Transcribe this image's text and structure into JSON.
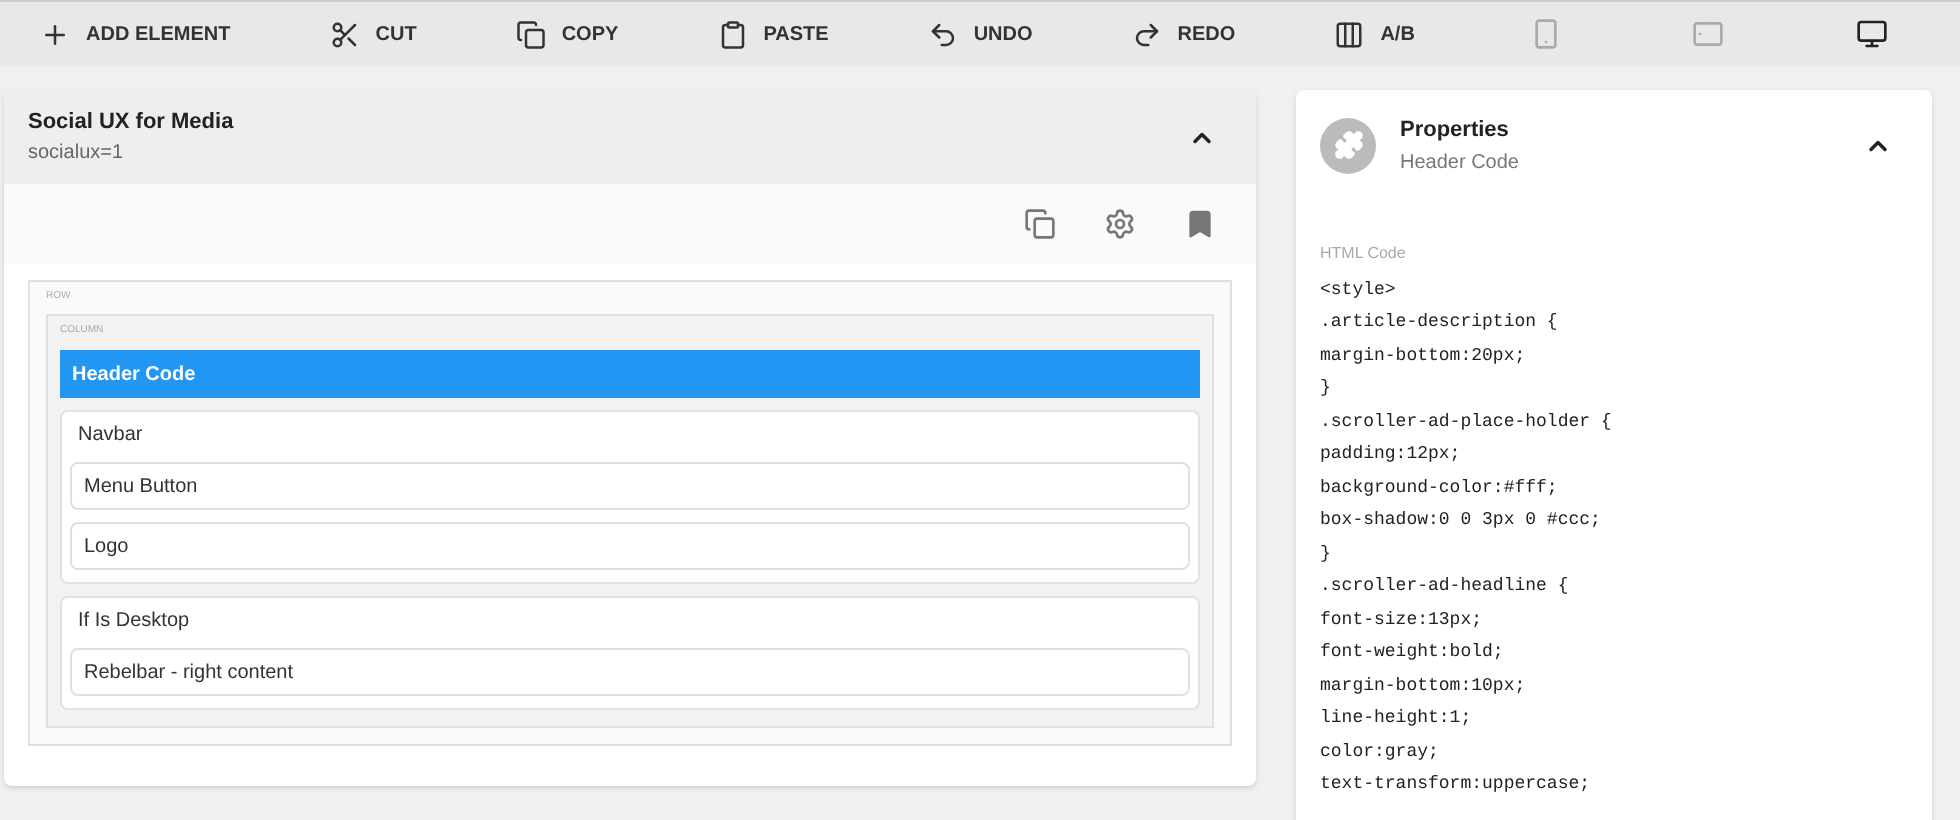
{
  "toolbar": [
    {
      "kind": "action",
      "label": "ADD ELEMENT"
    },
    {
      "kind": "action",
      "label": "CUT"
    },
    {
      "kind": "action",
      "label": "COPY"
    },
    {
      "kind": "action",
      "label": "PASTE"
    },
    {
      "kind": "action",
      "label": "UNDO"
    },
    {
      "kind": "action",
      "label": "REDO"
    },
    {
      "kind": "action",
      "label": "A/B"
    },
    {
      "kind": "device",
      "selected": false
    },
    {
      "kind": "device",
      "selected": false
    },
    {
      "kind": "device",
      "selected": true
    }
  ],
  "layout_panel": {
    "title": "Social UX for Media",
    "subtitle": "socialux=1",
    "expanded": true,
    "row_label": "ROW",
    "column_label": "COLUMN",
    "elements": [
      {
        "kind": "element",
        "label": "Header Code",
        "selected": true
      },
      {
        "kind": "group",
        "label": "Navbar",
        "children": [
          {
            "kind": "element",
            "label": "Menu Button",
            "selected": false
          },
          {
            "kind": "element",
            "label": "Logo",
            "selected": false
          }
        ]
      },
      {
        "kind": "group",
        "label": "If Is Desktop",
        "children": [
          {
            "kind": "element",
            "label": "Rebelbar - right content",
            "selected": false
          }
        ]
      }
    ]
  },
  "properties_panel": {
    "title": "Properties",
    "subtitle": "Header Code",
    "expanded": true,
    "field_label": "HTML Code",
    "code_lines": [
      "<style>",
      ".article-description {",
      "margin-bottom:20px;",
      "}",
      ".scroller-ad-place-holder {",
      "padding:12px;",
      "background-color:#fff;",
      "box-shadow:0 0 3px 0 #ccc;",
      "}",
      ".scroller-ad-headline {",
      "font-size:13px;",
      "font-weight:bold;",
      "margin-bottom:10px;",
      "line-height:1;",
      "color:gray;",
      "text-transform:uppercase;"
    ]
  }
}
